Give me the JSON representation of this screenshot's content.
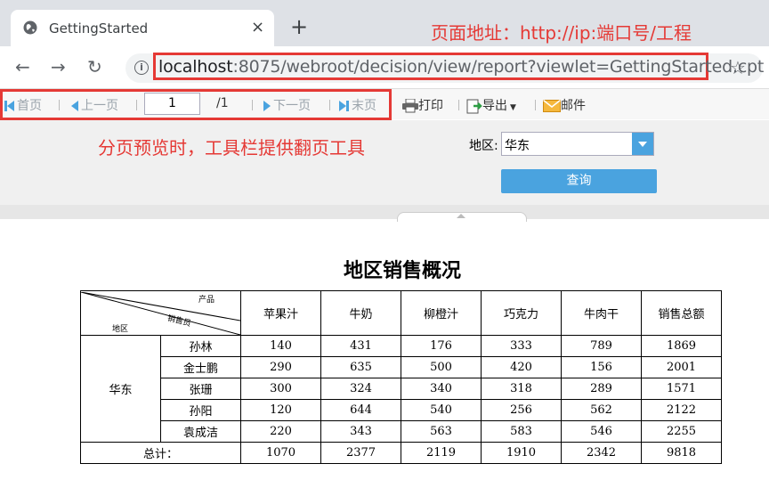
{
  "browser": {
    "tab_title": "GettingStarted",
    "tab_close": "×",
    "new_tab": "+",
    "back": "←",
    "forward": "→",
    "reload": "↻",
    "info": "i",
    "url_host": "localhost",
    "url_rest": ":8075/webroot/decision/view/report?viewlet=GettingStarted.cpt",
    "star": "☆"
  },
  "annotations": {
    "url_note": "页面地址：http://ip:端口号/工程",
    "toolbar_note": "分页预览时，工具栏提供翻页工具",
    "color": "#e53935"
  },
  "toolbar": {
    "first": "首页",
    "prev": "上一页",
    "page_value": "1",
    "page_total": "/1",
    "next": "下一页",
    "last": "末页",
    "print": "打印",
    "export": "导出",
    "mail": "邮件"
  },
  "params": {
    "region_label": "地区:",
    "region_value": "华东",
    "query": "查询"
  },
  "report": {
    "title": "地区销售概况",
    "corner_product": "产品",
    "corner_salesman": "销售员",
    "corner_region": "地区",
    "columns": [
      "苹果汁",
      "牛奶",
      "柳橙汁",
      "巧克力",
      "牛肉干",
      "销售总额"
    ],
    "region": "华东",
    "rows": [
      {
        "name": "孙林",
        "values": [
          "140",
          "431",
          "176",
          "333",
          "789",
          "1869"
        ]
      },
      {
        "name": "金士鹏",
        "values": [
          "290",
          "635",
          "500",
          "420",
          "156",
          "2001"
        ]
      },
      {
        "name": "张珊",
        "values": [
          "300",
          "324",
          "340",
          "318",
          "289",
          "1571"
        ]
      },
      {
        "name": "孙阳",
        "values": [
          "120",
          "644",
          "540",
          "256",
          "562",
          "2122"
        ]
      },
      {
        "name": "袁成洁",
        "values": [
          "220",
          "343",
          "563",
          "583",
          "546",
          "2255"
        ]
      }
    ],
    "total_label": "总计：",
    "totals": [
      "1070",
      "2377",
      "2119",
      "1910",
      "2342",
      "9818"
    ]
  },
  "colors": {
    "accent": "#4aa3df",
    "toolbar_bg": "#f7f7f7",
    "param_bg": "#f0f0f0"
  }
}
